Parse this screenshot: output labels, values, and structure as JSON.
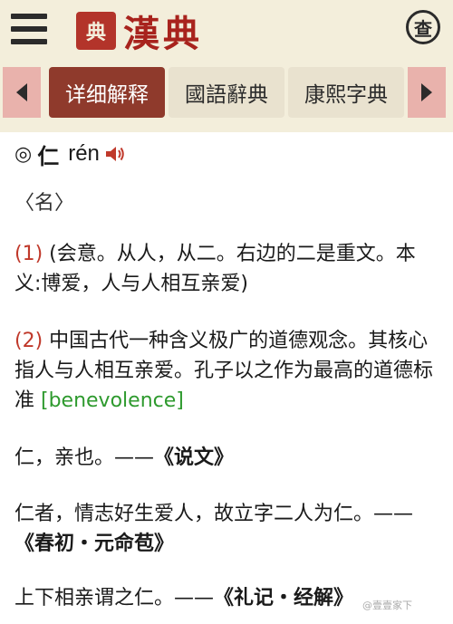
{
  "header": {
    "logo_seal": "典",
    "logo_text": "漢典",
    "search_label": "查"
  },
  "tabs": [
    {
      "label": "详细解释",
      "active": true
    },
    {
      "label": "國語辭典",
      "active": false
    },
    {
      "label": "康熙字典",
      "active": false
    }
  ],
  "entry": {
    "bullet": "◎",
    "character": "仁",
    "pinyin": "rén"
  },
  "part_of_speech": "〈名〉",
  "definitions": [
    {
      "num": "(1)",
      "text": " (会意。从人，从二。右边的二是重文。本义:博爱，人与人相互亲爱)"
    },
    {
      "num": "(2)",
      "text": " 中国古代一种含义极广的道德观念。其核心指人与人相互亲爱。孔子以之作为最高的道德标准 ",
      "english": "[benevolence]"
    }
  ],
  "quotes": [
    {
      "text": "仁，亲也。——",
      "source": "《说文》"
    },
    {
      "text": "仁者，情志好生爱人，故立字二人为仁。——",
      "source": "《春初・元命苞》"
    },
    {
      "text": "上下相亲谓之仁。——",
      "source": "《礼记・经解》"
    }
  ],
  "watermark": "@壹壹家下",
  "colors": {
    "header_bg": "#f3eedb",
    "logo_red": "#a8231d",
    "active_tab": "#8f3a2c",
    "arrow_bg": "#e9b2ac",
    "number_red": "#c0392b",
    "english_green": "#2e9a2e"
  },
  "icons": [
    "menu-icon",
    "search-icon",
    "chevron-left-icon",
    "chevron-right-icon",
    "speaker-icon"
  ]
}
